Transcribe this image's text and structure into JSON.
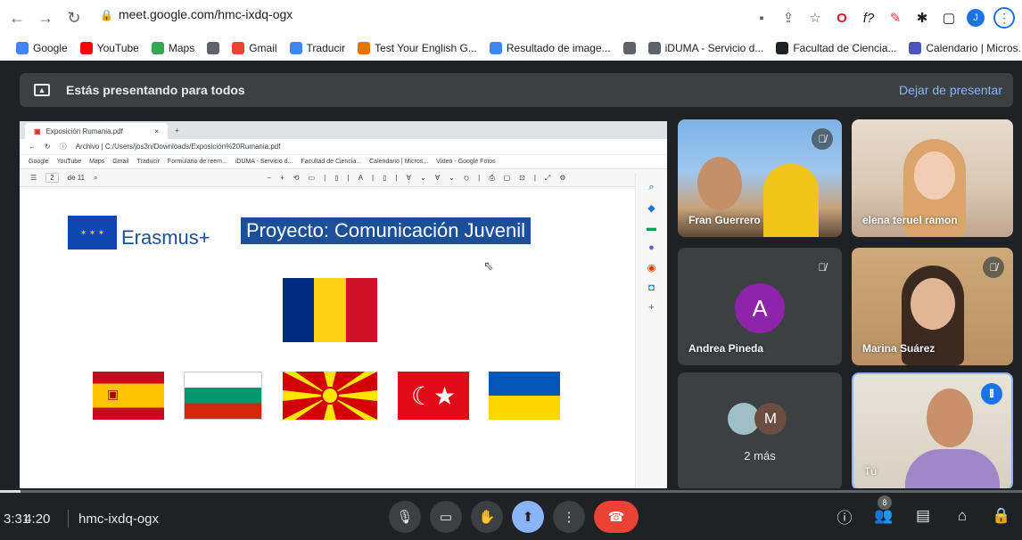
{
  "browser": {
    "url": "meet.google.com/hmc-ixdq-ogx",
    "profile_initial": "J",
    "bookmarks": [
      {
        "label": "Google",
        "icon": "google-icon",
        "color": "#4285f4"
      },
      {
        "label": "YouTube",
        "icon": "youtube-icon",
        "color": "#ff0000"
      },
      {
        "label": "Maps",
        "icon": "maps-icon",
        "color": "#34a853"
      },
      {
        "label": "",
        "icon": "globe-icon",
        "color": "#5f6368"
      },
      {
        "label": "Gmail",
        "icon": "gmail-icon",
        "color": "#ea4335"
      },
      {
        "label": "Traducir",
        "icon": "translate-icon",
        "color": "#4285f4"
      },
      {
        "label": "Test Your English G...",
        "icon": "test-icon",
        "color": "#e37400"
      },
      {
        "label": "Resultado de image...",
        "icon": "google-icon",
        "color": "#4285f4"
      },
      {
        "label": "",
        "icon": "globe-icon",
        "color": "#5f6368"
      },
      {
        "label": "iDUMA - Servicio d...",
        "icon": "globe-icon",
        "color": "#5f6368"
      },
      {
        "label": "Facultad de Ciencia...",
        "icon": "cv-icon",
        "color": "#202124"
      },
      {
        "label": "Calendario | Micros...",
        "icon": "teams-icon",
        "color": "#4b53bc"
      }
    ],
    "bookmarks_more": "»"
  },
  "meet": {
    "presenting_text": "Estás presentando para todos",
    "stop_presenting": "Dejar de presentar",
    "time": "3:31",
    "time_overlap": "4:20",
    "meeting_code": "hmc-ixdq-ogx",
    "people_count": "8",
    "progress": 0.02
  },
  "shared_screen": {
    "tab_title": "Exposición Rumania.pdf",
    "address": "Archivo  |  C:/Users/jos3n/Downloads/Exposición%20Rumania.pdf",
    "bookmarks": [
      "Google",
      "YouTube",
      "Maps",
      "Gmail",
      "Traducir",
      "Formulario de reem...",
      "iDUMA - Servicio d...",
      "Facultad de Ciencia...",
      "Calendario | Micros...",
      "Vídeo - Google Fotos"
    ],
    "page_num": "2",
    "page_total": "de 11",
    "slide_erasmus": "Erasmus+",
    "slide_title": "Proyecto: Comunicación Juvenil"
  },
  "participants": [
    {
      "name": "Fran Guerrero",
      "muted": true
    },
    {
      "name": "elena teruel ramon",
      "muted": false
    },
    {
      "name": "Andrea Pineda",
      "muted": true,
      "initial": "A"
    },
    {
      "name": "Marina Suárez",
      "muted": true
    },
    {
      "name": "2 más",
      "initial": "M"
    },
    {
      "name": "Tú",
      "speaking": true
    }
  ]
}
